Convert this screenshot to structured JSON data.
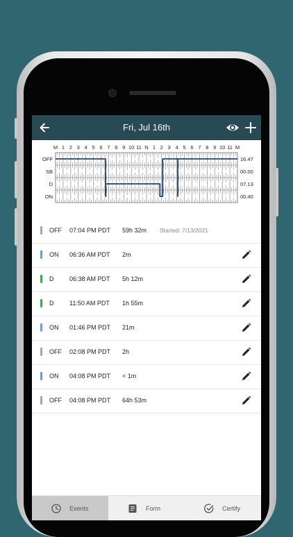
{
  "header": {
    "title": "Fri, Jul 16th"
  },
  "graph": {
    "hour_labels": [
      "M",
      "1",
      "2",
      "3",
      "4",
      "5",
      "6",
      "7",
      "8",
      "9",
      "10",
      "11",
      "N",
      "1",
      "2",
      "3",
      "4",
      "5",
      "6",
      "7",
      "8",
      "9",
      "10",
      "11",
      "M"
    ],
    "status_rows": [
      "OFF",
      "SB",
      "D",
      "ON"
    ],
    "totals": [
      "16.47",
      "00.00",
      "07.13",
      "00.40"
    ],
    "colors": {
      "grid": "#777777",
      "line": "#1e3f6e"
    }
  },
  "events": [
    {
      "status": "OFF",
      "time": "07:04 PM PDT",
      "duration": "59h 32m",
      "note": "Started: 7/13/2021",
      "color": "#a6a6a6",
      "editable": false
    },
    {
      "status": "ON",
      "time": "06:36 AM PDT",
      "duration": "2m",
      "note": "",
      "color": "#6f9ed0",
      "editable": true
    },
    {
      "status": "D",
      "time": "06:38 AM PDT",
      "duration": "5h 12m",
      "note": "",
      "color": "#3fae4a",
      "editable": true
    },
    {
      "status": "D",
      "time": "11:50 AM PDT",
      "duration": "1h 55m",
      "note": "",
      "color": "#3fae4a",
      "editable": true
    },
    {
      "status": "ON",
      "time": "01:46 PM PDT",
      "duration": "21m",
      "note": "",
      "color": "#6f9ed0",
      "editable": true
    },
    {
      "status": "OFF",
      "time": "02:08 PM PDT",
      "duration": "2h",
      "note": "",
      "color": "#a6a6a6",
      "editable": true
    },
    {
      "status": "ON",
      "time": "04:08 PM PDT",
      "duration": "< 1m",
      "note": "",
      "color": "#6f9ed0",
      "editable": true
    },
    {
      "status": "OFF",
      "time": "04:08 PM PDT",
      "duration": "64h 53m",
      "note": "",
      "color": "#a6a6a6",
      "editable": true
    }
  ],
  "tabs": [
    {
      "label": "Events",
      "icon": "clock-icon",
      "active": true
    },
    {
      "label": "Form",
      "icon": "document-icon",
      "active": false
    },
    {
      "label": "Certify",
      "icon": "check-circle-icon",
      "active": false
    }
  ]
}
